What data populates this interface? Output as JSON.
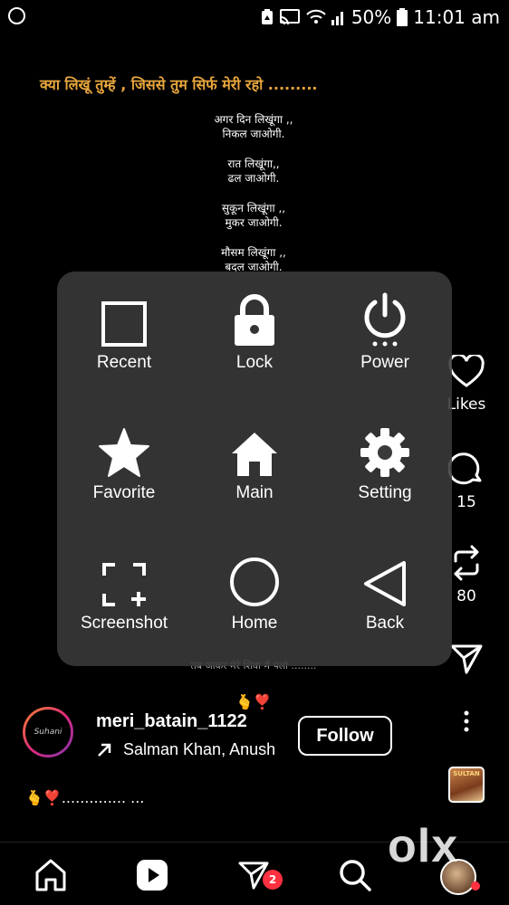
{
  "status": {
    "battery": "50%",
    "time": "11:01 am"
  },
  "poem": {
    "title": "क्या लिखूं तुम्हें , जिससे तुम सिर्फ मेरी रहो .........",
    "stanzas": [
      [
        "अगर दिन लिखूंगा ,,",
        "निकल जाओगी."
      ],
      [
        "रात लिखूंगा,,",
        "ढल जाओगी."
      ],
      [
        "सुकून लिखूंगा ,,",
        "मुकर जाओगी."
      ],
      [
        "मौसम लिखूंगा ,,",
        "बदल जाओगी."
      ]
    ],
    "bottom_line": "तब जाकर मेरे शिवा में पलो ........"
  },
  "overlay": {
    "items": [
      {
        "label": "Recent",
        "icon": "square-icon"
      },
      {
        "label": "Lock",
        "icon": "lock-icon"
      },
      {
        "label": "Power",
        "icon": "power-icon"
      },
      {
        "label": "Favorite",
        "icon": "star-icon"
      },
      {
        "label": "Main",
        "icon": "house-icon"
      },
      {
        "label": "Setting",
        "icon": "gear-icon"
      },
      {
        "label": "Screenshot",
        "icon": "screenshot-icon"
      },
      {
        "label": "Home",
        "icon": "circle-icon"
      },
      {
        "label": "Back",
        "icon": "triangle-back-icon"
      }
    ]
  },
  "side": {
    "likes_label": "Likes",
    "comments_count": "15",
    "reposts_count": "80"
  },
  "account": {
    "username": "meri_batain_1122",
    "emoji": "🫰❣️",
    "music": "Salman Khan, Anush",
    "follow_label": "Follow",
    "caption": "🫰❣️.............. ...",
    "avatar_text": "Suhani",
    "thumb_text": "SULTAN"
  },
  "nav": {
    "badge_count": "2",
    "watermark": "olx"
  },
  "colors": {
    "title_color": "#e8a63c",
    "overlay_bg": "#3a3a3a",
    "badge": "#ff3040"
  }
}
